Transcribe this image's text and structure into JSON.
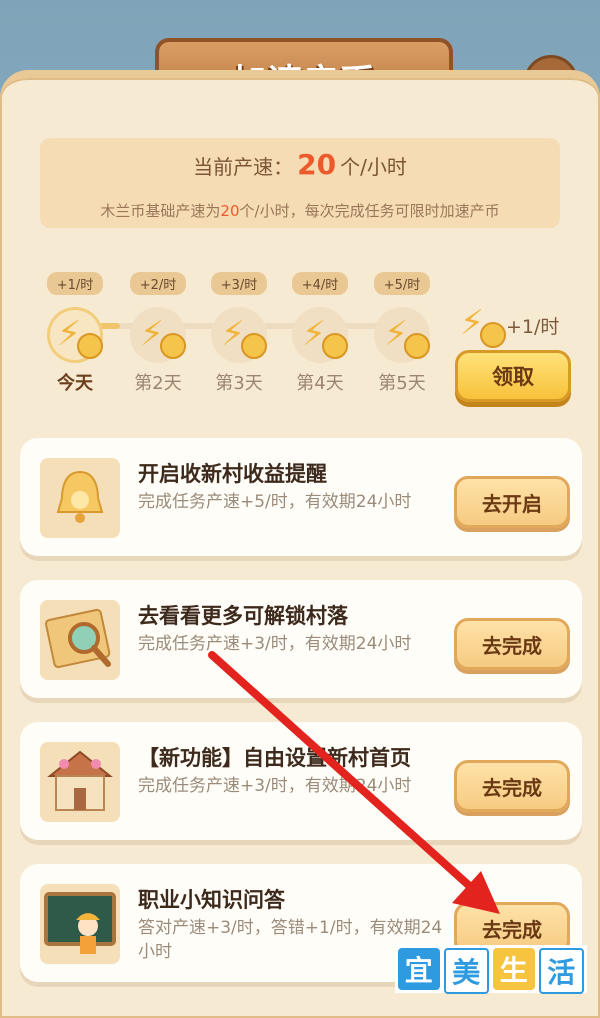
{
  "title": "加速产币",
  "close_label": "✕",
  "speed": {
    "label": "当前产速：",
    "value": "20",
    "unit": "个/小时",
    "note_prefix": "木兰币基础产速为",
    "note_value": "20",
    "note_suffix": "个/小时，每次完成任务可限时加速产币"
  },
  "days": [
    {
      "bonus": "+1/时",
      "label": "今天"
    },
    {
      "bonus": "+2/时",
      "label": "第2天"
    },
    {
      "bonus": "+3/时",
      "label": "第3天"
    },
    {
      "bonus": "+4/时",
      "label": "第4天"
    },
    {
      "bonus": "+5/时",
      "label": "第5天"
    }
  ],
  "reward": {
    "bonus": "+1/时",
    "claim_label": "领取"
  },
  "tasks": [
    {
      "title": "开启收新村收益提醒",
      "desc": "完成任务产速+5/时，有效期24小时",
      "button": "去开启",
      "icon": "bell-icon"
    },
    {
      "title": "去看看更多可解锁村落",
      "desc": "完成任务产速+3/时，有效期24小时",
      "button": "去完成",
      "icon": "map-icon"
    },
    {
      "title": "【新功能】自由设置新村首页",
      "desc": "完成任务产速+3/时，有效期24小时",
      "button": "去完成",
      "icon": "house-icon"
    },
    {
      "title": "职业小知识问答",
      "desc": "答对产速+3/时，答错+1/时，有效期24小时",
      "button": "去完成",
      "icon": "teacher-icon"
    }
  ],
  "watermark": [
    "宜",
    "美",
    "生",
    "活"
  ],
  "colors": {
    "accent": "#ec5a2b",
    "arrow": "#e3231d",
    "gold": "#f6c43e"
  }
}
